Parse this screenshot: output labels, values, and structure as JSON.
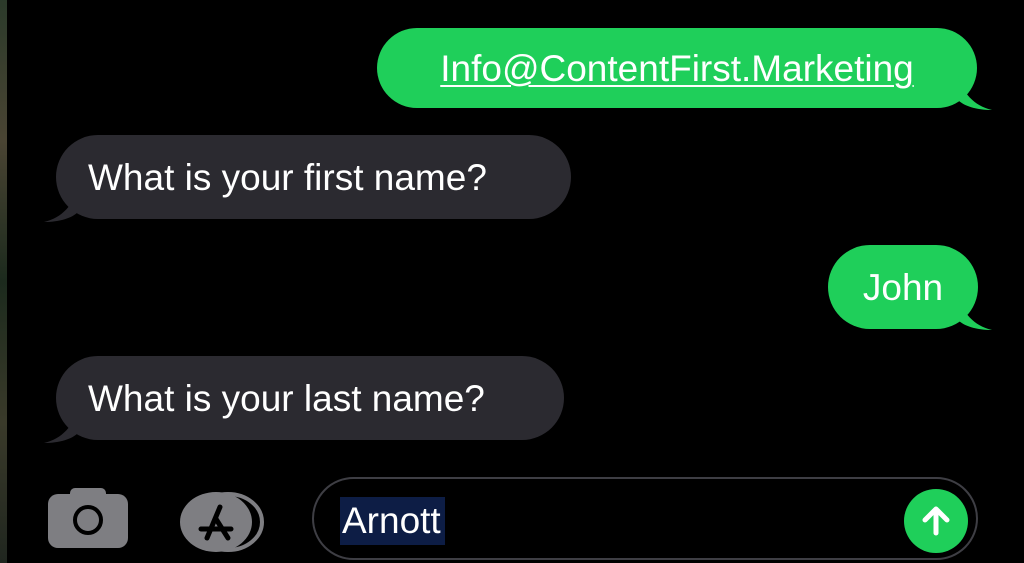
{
  "conversation": {
    "messages": [
      {
        "direction": "sent",
        "text": "Info@ContentFirst.Marketing",
        "is_link": true
      },
      {
        "direction": "received",
        "text": "What is your first name?"
      },
      {
        "direction": "sent",
        "text": "John"
      },
      {
        "direction": "received",
        "text": "What is your last name?"
      }
    ]
  },
  "composer": {
    "camera_icon": "camera-icon",
    "apps_icon": "app-store-icon",
    "input_value": "Arnott",
    "send_icon": "arrow-up-icon"
  },
  "colors": {
    "sent_bubble": "#1fcf5a",
    "received_bubble": "#2b2a30",
    "background": "#000000",
    "text_selection": "#0d1d45"
  }
}
